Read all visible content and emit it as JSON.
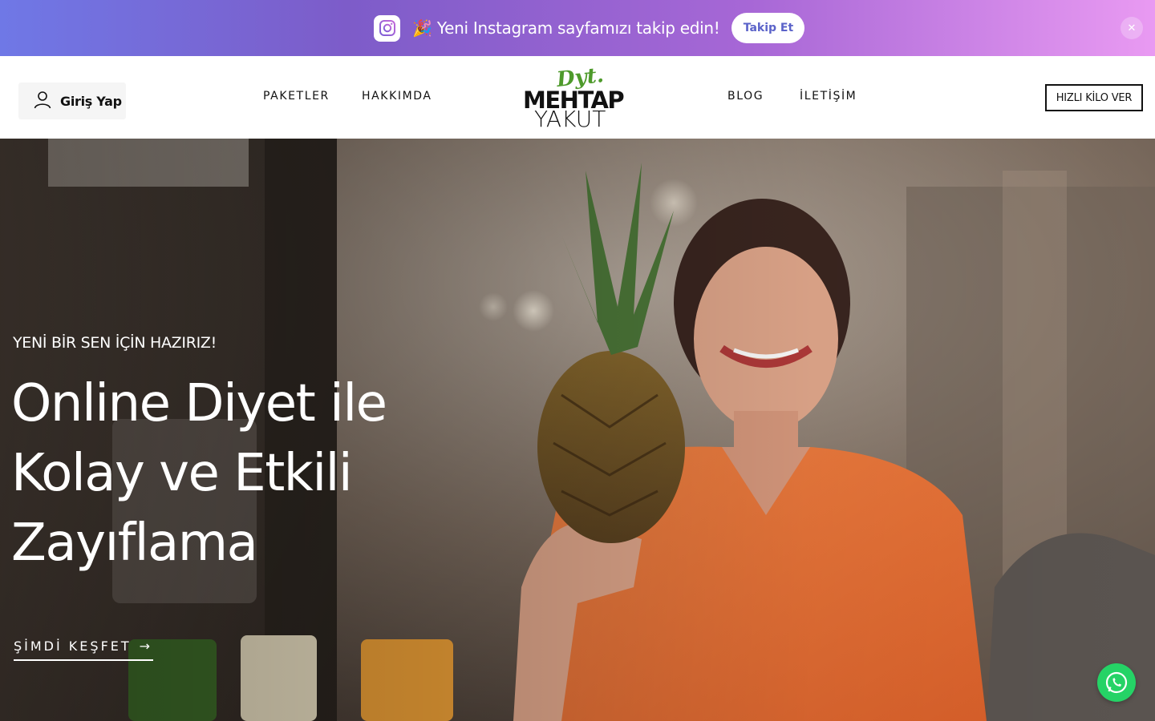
{
  "announcement": {
    "instagram_icon": "instagram-icon",
    "party_emoji": "🎉",
    "text": "Yeni Instagram sayfamızı takip edin!",
    "follow_label": "Takip Et",
    "close_icon": "close-icon"
  },
  "header": {
    "login_label": "Giriş Yap",
    "nav_left": [
      "PAKETLER",
      "HAKKIMDA"
    ],
    "nav_right": [
      "BLOG",
      "İLETİŞİM"
    ],
    "logo": {
      "dyt": "Dyt.",
      "name": "MEHTAP",
      "surname": "YAKUT"
    },
    "cta_label": "HIZLI KİLO VER"
  },
  "hero": {
    "eyebrow": "YENİ BİR SEN İÇİN HAZIRIZ!",
    "title_lines": [
      "Online Diyet ile",
      "Kolay ve Etkili",
      "Zayıflama"
    ],
    "cta_label": "ŞİMDİ KEŞFET",
    "cta_arrow": "→"
  },
  "colors": {
    "announce_start": "#6f78e6",
    "announce_end": "#e99af2",
    "logo_green": "#4e9a2b",
    "whatsapp": "#25d366",
    "shirt_orange": "#f07a3c"
  },
  "floating": {
    "whatsapp_icon": "whatsapp-icon"
  }
}
